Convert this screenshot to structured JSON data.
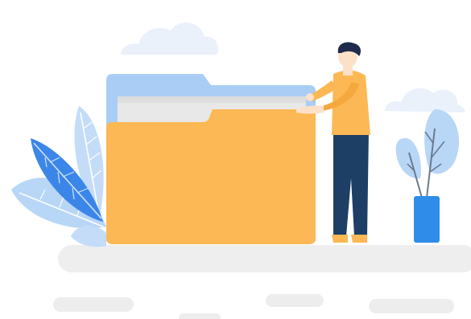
{
  "illustration": {
    "subject": "person-with-folder",
    "icons": [
      "cloud-icon",
      "folder-icon",
      "person-figure",
      "leaf-icon",
      "potted-plant-icon"
    ]
  },
  "colors": {
    "background": "#ffffff",
    "ground": "#ececec",
    "cloud": "#eaf1fb",
    "folder_back": "#a9cdf4",
    "folder_paper": "#e8e8e8",
    "folder_front": "#fcb854",
    "shirt": "#fcb854",
    "skin": "#fde0c8",
    "hair": "#1e2b4c",
    "pants": "#1d3f66",
    "shoes": "#fcb854",
    "leaf_dark": "#3b86e8",
    "leaf_light": "#b5d3f6",
    "pot": "#2f8ce8"
  }
}
